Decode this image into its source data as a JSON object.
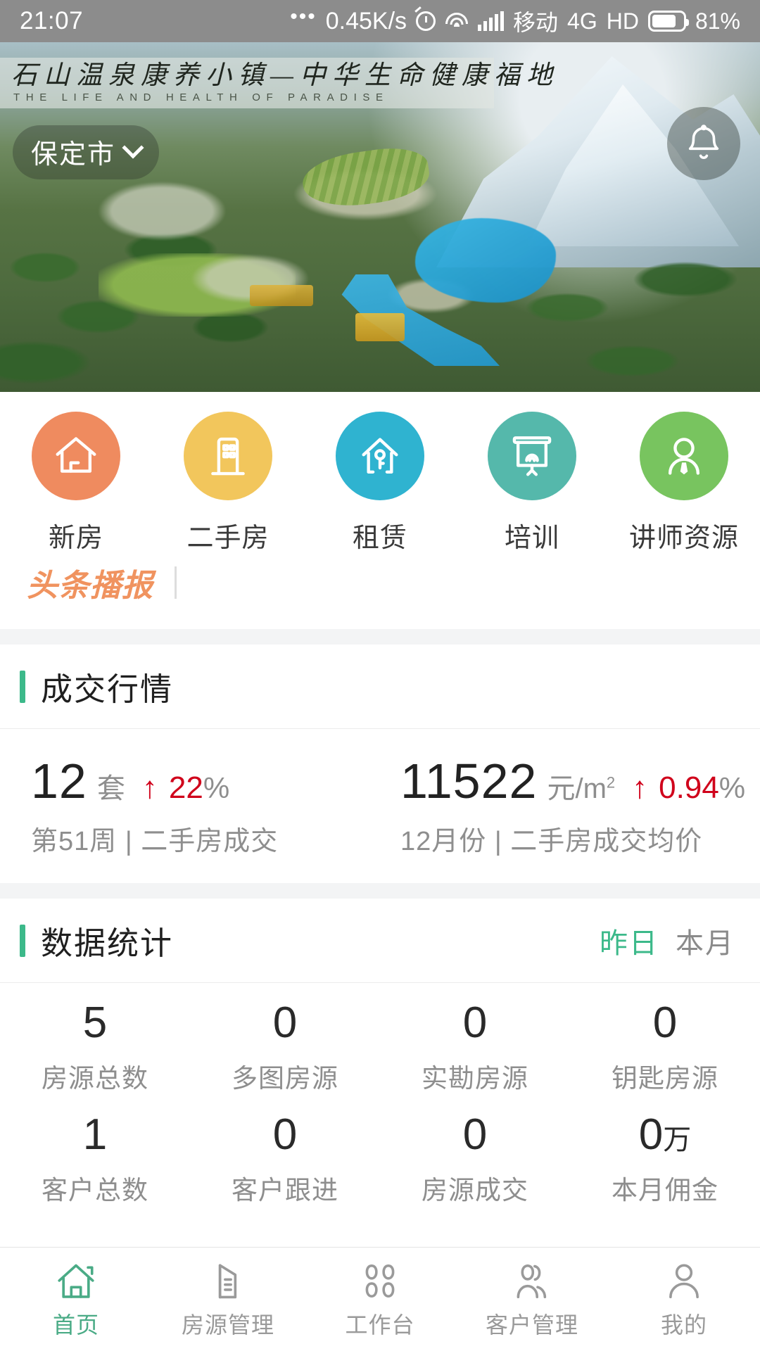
{
  "status_bar": {
    "time": "21:07",
    "dots": "•••",
    "net_speed": "0.45K/s",
    "carrier": "移动",
    "network": "4G",
    "hd": "HD",
    "battery": "81%",
    "icons": [
      "alarm-icon",
      "wifi-icon",
      "signal-icon",
      "battery-icon"
    ]
  },
  "hero": {
    "title_cn": "石山温泉康养小镇—中华生命健康福地",
    "title_en": "THE LIFE AND HEALTH OF PARADISE",
    "city": "保定市",
    "chevron": "chevron-down-icon",
    "bell": "bell-icon"
  },
  "quicknav": {
    "items": [
      {
        "label": "新房",
        "icon": "house-icon",
        "color": "#ef8b5f"
      },
      {
        "label": "二手房",
        "icon": "apartment-icon",
        "color": "#f2c65c"
      },
      {
        "label": "租赁",
        "icon": "house-key-icon",
        "color": "#2fb3d0"
      },
      {
        "label": "培训",
        "icon": "projector-icon",
        "color": "#55b8ab"
      },
      {
        "label": "讲师资源",
        "icon": "lecturer-icon",
        "color": "#78c45f"
      }
    ]
  },
  "headline": {
    "logo": "头条播报"
  },
  "market": {
    "title": "成交行情",
    "accent": "#3cb98a",
    "cards": [
      {
        "value": "12",
        "unit": "套",
        "arrow": "↑",
        "change": "22",
        "percent": "%",
        "sub": "第51周 | 二手房成交"
      },
      {
        "value": "11522",
        "unit": "元/m",
        "unit_sup": "2",
        "arrow": "↑",
        "change": "0.94",
        "percent": "%",
        "sub": "12月份 | 二手房成交均价"
      }
    ]
  },
  "statistics": {
    "title": "数据统计",
    "toggle_active": "昨日",
    "toggle_inactive": "本月",
    "rows": [
      [
        {
          "value": "5",
          "suffix": "",
          "label": "房源总数"
        },
        {
          "value": "0",
          "suffix": "",
          "label": "多图房源"
        },
        {
          "value": "0",
          "suffix": "",
          "label": "实勘房源"
        },
        {
          "value": "0",
          "suffix": "",
          "label": "钥匙房源"
        }
      ],
      [
        {
          "value": "1",
          "suffix": "",
          "label": "客户总数"
        },
        {
          "value": "0",
          "suffix": "",
          "label": "客户跟进"
        },
        {
          "value": "0",
          "suffix": "",
          "label": "房源成交"
        },
        {
          "value": "0",
          "suffix": "万",
          "label": "本月佣金"
        }
      ]
    ]
  },
  "tabbar": {
    "items": [
      {
        "label": "首页",
        "icon": "home-icon",
        "active": true
      },
      {
        "label": "房源管理",
        "icon": "building-icon",
        "active": false
      },
      {
        "label": "工作台",
        "icon": "grid-icon",
        "active": false
      },
      {
        "label": "客户管理",
        "icon": "users-icon",
        "active": false
      },
      {
        "label": "我的",
        "icon": "person-icon",
        "active": false
      }
    ],
    "active_color": "#4aab86",
    "inactive_color": "#9a9a9a"
  }
}
